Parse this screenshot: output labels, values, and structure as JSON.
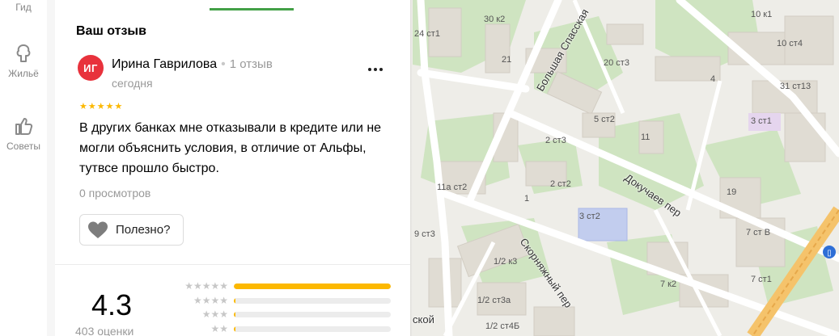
{
  "sidebar": {
    "items": [
      {
        "label": "Гид",
        "icon": "guide-icon"
      },
      {
        "label": "Жильё",
        "icon": "housing-icon"
      },
      {
        "label": "Советы",
        "icon": "thumb-up-icon"
      }
    ]
  },
  "review": {
    "section_title": "Ваш отзыв",
    "avatar_initials": "ИГ",
    "author": "Ирина Гаврилова",
    "author_reviews": "1 отзыв",
    "date": "сегодня",
    "stars": 5,
    "text": "В других банках мне отказывали в кредите или не могли объяснить условия, в отличие от Альфы, тутвсе прошло быстро.",
    "views": "0 просмотров",
    "useful_label": "Полезно?"
  },
  "rating": {
    "value": "4.3",
    "count_label": "403 оценки",
    "distribution": [
      {
        "stars": "★★★★★",
        "fraction": 1.0
      },
      {
        "stars": "★★★★",
        "fraction": 0.01
      },
      {
        "stars": "★★★",
        "fraction": 0.01
      },
      {
        "stars": "★★",
        "fraction": 0.01
      }
    ]
  },
  "map": {
    "streets": [
      "Большая Спасская",
      "Докучаев пер",
      "Скорняжный пер",
      "Скорняжный пер"
    ],
    "buildings": [
      "30 к2",
      "24 ст1",
      "21",
      "20 ст3",
      "4",
      "10 к1",
      "10 ст4",
      "31 ст13",
      "5 ст2",
      "3 ст1",
      "2 ст3",
      "11",
      "2 ст2",
      "1",
      "11а ст2",
      "19",
      "3 ст2",
      "9 ст3",
      "1/2 к3",
      "7 ст В",
      "7 ст1",
      "7 к2",
      "1/2 ст3а",
      "1/2 ст4Б"
    ],
    "partial_street": "ской",
    "accent": "#43a047",
    "star_color": "#fcb800"
  }
}
